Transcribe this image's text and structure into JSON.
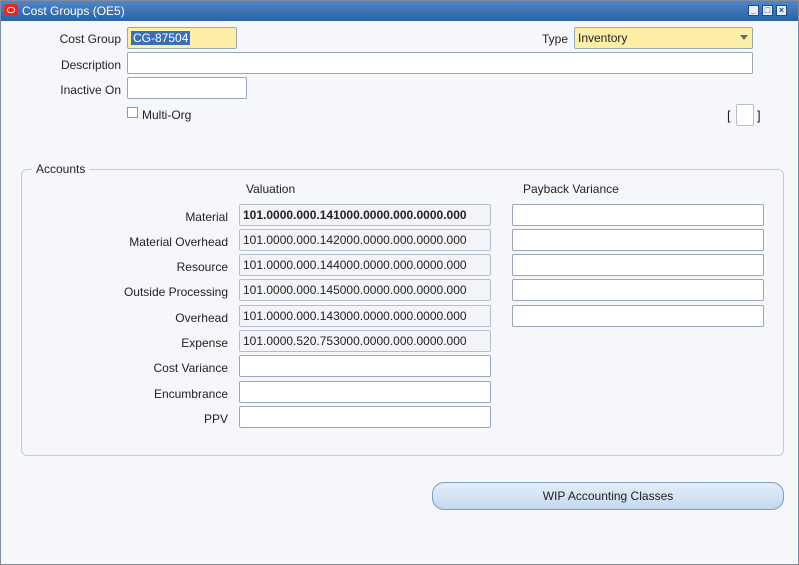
{
  "window": {
    "title": "Cost Groups (OE5)"
  },
  "header": {
    "cost_group_label": "Cost Group",
    "cost_group_value": "CG-87504",
    "type_label": "Type",
    "type_value": "Inventory",
    "description_label": "Description",
    "description_value": "",
    "inactive_on_label": "Inactive On",
    "inactive_on_value": "",
    "multi_org_label": "Multi-Org",
    "bracket_open": "[",
    "bracket_close": "]"
  },
  "accounts": {
    "legend": "Accounts",
    "valuation_header": "Valuation",
    "payback_header": "Payback Variance",
    "rows": [
      {
        "label": "Material",
        "valuation": "101.0000.000.141000.0000.000.0000.000",
        "payback": ""
      },
      {
        "label": "Material Overhead",
        "valuation": "101.0000.000.142000.0000.000.0000.000",
        "payback": ""
      },
      {
        "label": "Resource",
        "valuation": "101.0000.000.144000.0000.000.0000.000",
        "payback": ""
      },
      {
        "label": "Outside Processing",
        "valuation": "101.0000.000.145000.0000.000.0000.000",
        "payback": ""
      },
      {
        "label": "Overhead",
        "valuation": "101.0000.000.143000.0000.000.0000.000",
        "payback": ""
      },
      {
        "label": "Expense",
        "valuation": "101.0000.520.753000.0000.000.0000.000"
      },
      {
        "label": "Cost Variance",
        "valuation": ""
      },
      {
        "label": "Encumbrance",
        "valuation": ""
      },
      {
        "label": "PPV",
        "valuation": ""
      }
    ]
  },
  "buttons": {
    "wip_label": "WIP Accounting Classes"
  }
}
